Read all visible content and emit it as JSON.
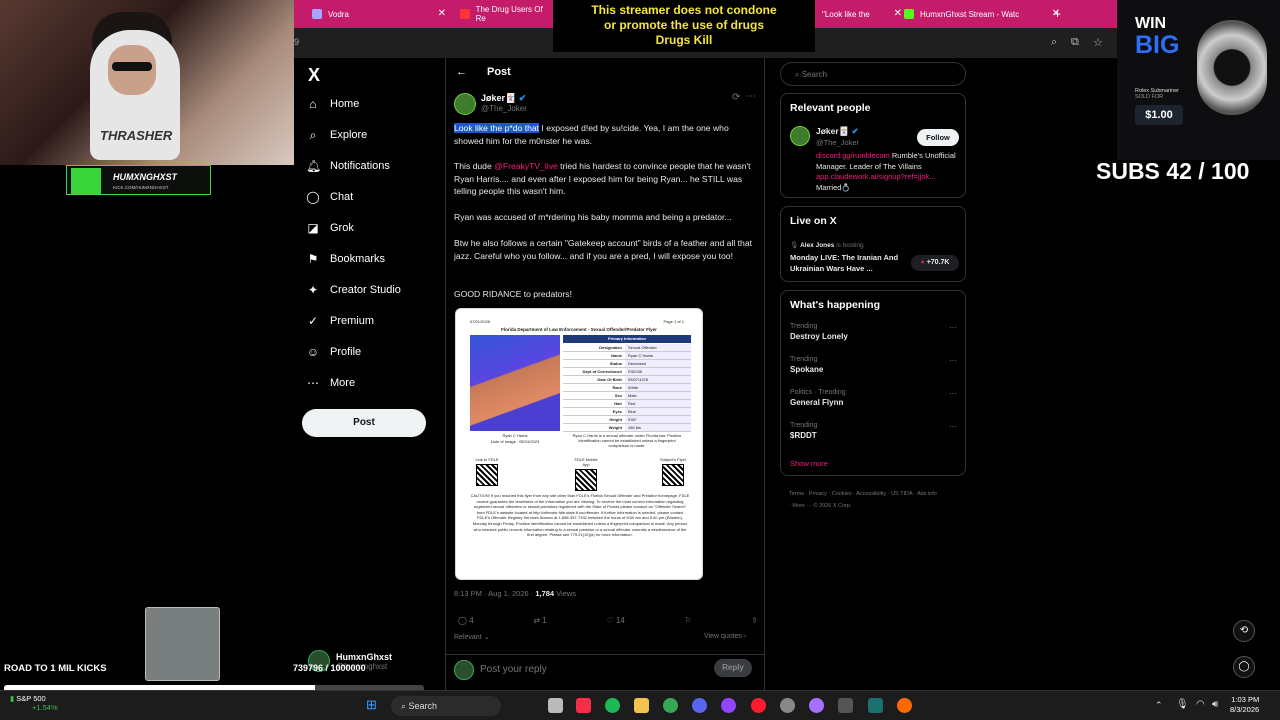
{
  "browser": {
    "tabs": [
      {
        "label": "Vodra",
        "color": "#a6a6ff"
      },
      {
        "label": "The Drug Users Of Re",
        "color": "#ff3333"
      },
      {
        "label": "\"Look like the",
        "color": "#000000"
      },
      {
        "label": "HumxnGhxst Stream - Watc",
        "color": "#53fc18"
      }
    ],
    "url": "9"
  },
  "disclaimer": {
    "line1": "This streamer does not condone",
    "line2": "or promote the use of drugs",
    "line3": "Drugs Kill"
  },
  "nav": {
    "logo": "X",
    "items": [
      {
        "label": "Home",
        "icon": "⌂"
      },
      {
        "label": "Explore",
        "icon": "⌕"
      },
      {
        "label": "Notifications",
        "icon": "🔔"
      },
      {
        "label": "Chat",
        "icon": "◯"
      },
      {
        "label": "Grok",
        "icon": "◪"
      },
      {
        "label": "Bookmarks",
        "icon": "🔖"
      },
      {
        "label": "Creator Studio",
        "icon": "✦"
      },
      {
        "label": "Premium",
        "icon": "✓"
      },
      {
        "label": "Profile",
        "icon": "👤"
      },
      {
        "label": "More",
        "icon": "⋯"
      }
    ],
    "post_label": "Post",
    "account_name": "HumxnGhxst",
    "account_handle": "@humxnghxst"
  },
  "post": {
    "header": "Post",
    "author_name": "Jøker🃏",
    "author_handle": "@The_Joker",
    "para1_hl": "Look like the p*do that",
    "para1_rest": " I exposed d!ed by su!cide. Yea, I am the one who showed him for the m0nster he was.",
    "para2_pre": "This dude ",
    "para2_mention": "@FreakyTV_live",
    "para2_post": " tried his hardest to convince people that he wasn't Ryan Harris.... and even after I exposed him for being Ryan... he STILL was telling people this wasn't him.",
    "para3": "Ryan was accused of m*rdering his baby momma and being a predator...",
    "para4": "Btw he also follows a certain \"Gatekeep account\" birds of a feather and all that jazz. Careful who you follow... and if you are a pred, I will expose you too!",
    "para5": "GOOD RIDANCE to predators!",
    "timestamp": "8:13 PM · Aug 1, 2026 · ",
    "views": "1,784",
    "views_label": " Views",
    "stats": {
      "replies": "4",
      "reposts": "1",
      "likes": "14"
    },
    "relevant": "Relevant",
    "view_quotes": "View quotes",
    "reply_placeholder": "Post your reply",
    "reply_btn": "Reply"
  },
  "flyer": {
    "date": "07/01/2026",
    "page": "Page 1 of 1",
    "title": "Florida Department of Law Enforcement - Sexual Offender/Predator Flyer",
    "section": "Primary Information",
    "fields": [
      [
        "Designation",
        "Sexual Offender"
      ],
      [
        "Name",
        "Ryan C Harris"
      ],
      [
        "Status",
        "Deceased"
      ],
      [
        "Dept of Corrections#",
        "R32035"
      ],
      [
        "Date Of Birth",
        "05/07/1978"
      ],
      [
        "Race",
        "White"
      ],
      [
        "Sex",
        "Male"
      ],
      [
        "Hair",
        "Red"
      ],
      [
        "Eyes",
        "Blue"
      ],
      [
        "Height",
        "5'06\""
      ],
      [
        "Weight",
        "180 lbs"
      ]
    ],
    "photo_caption": "Ryan C Harris",
    "photo_date": "Date of Image : 05/19/2023",
    "side_note": "Ryan C Harris is a sexual offender under Florida law. Positive identification cannot be established unless a fingerprint comparison is made.",
    "qr_labels": [
      "Link to FDLE",
      "FDLE Mobile App",
      "Subject's Flyer"
    ],
    "caution": "CAUTION! If you reached this flyer from any site other than FDLE's Florida Sexual Offender and Predator homepage, FDLE cannot guarantee the timeliness of the information you are viewing. To receive the most current information regarding registered sexual offenders or sexual predators registered with the State of Florida please conduct an \"Offender Search\" from FDLE's website located at http://offender.fdle.state.fl.us/offender. If further information is needed, please contact FDLE's Offender Registry Services Bureau at 1-888-357-7332 between the hours of 8:00 am and 5:00 pm (Eastern), Monday through Friday. Positive identification cannot be established unless a fingerprint comparison is made. Any person who misuses public records information relating to a sexual predator or a sexual offender commits a misdemeanor of the first degree. Please see 775.21(10)(d) for more information."
  },
  "right": {
    "search_placeholder": "Search",
    "relevant_title": "Relevant people",
    "person_name": "Jøker🃏",
    "person_handle": "@The_Joker",
    "follow_label": "Follow",
    "person_bio_link": "discord.gg/rumblecom",
    "person_bio": " Rumble's Unofficial Manager. Leader of The Villains ",
    "person_bio_link2": "app.claudework.ai/signup?ref=jjok...",
    "person_bio_end": " Married💍",
    "live_title": "Live on X",
    "live_host": "Alex Jones",
    "live_hosting": " is hosting",
    "live_text": "Monday LIVE: The Iranian And Ukrainian Wars Have ...",
    "live_count": "+70.7K",
    "happening_title": "What's happening",
    "trends": [
      {
        "cat": "Trending",
        "name": "Destroy Lonely"
      },
      {
        "cat": "Trending",
        "name": "Spokane"
      },
      {
        "cat": "Politics · Trending",
        "name": "General Flynn"
      },
      {
        "cat": "Trending",
        "name": "$RDDT"
      }
    ],
    "show_more": "Show more",
    "footer": "Terms · Privacy · Cookies · Accessibility · US TIDA · Ads info · More ··· © 2026 X Corp."
  },
  "stream": {
    "shirt_text": "THRASHER",
    "badge_name": "HUMXNGHXST",
    "badge_url": "KICK.COM/HUMXNGHXST",
    "ad_win": "WIN",
    "ad_big": "BIG",
    "ad_model": "Rolex Submariner",
    "ad_sold": "SOLD FOR",
    "ad_price": "$1.00",
    "subs": "SUBS 42 / 100",
    "road_label": "ROAD TO 1 MIL KICKS",
    "road_count": "739796 / 1000000",
    "road_progress": 0.7398
  },
  "taskbar": {
    "stock_name": "S&P 500",
    "stock_change": "+1.54%",
    "search": "Search",
    "time": "1:03 PM",
    "date": "8/3/2026"
  }
}
